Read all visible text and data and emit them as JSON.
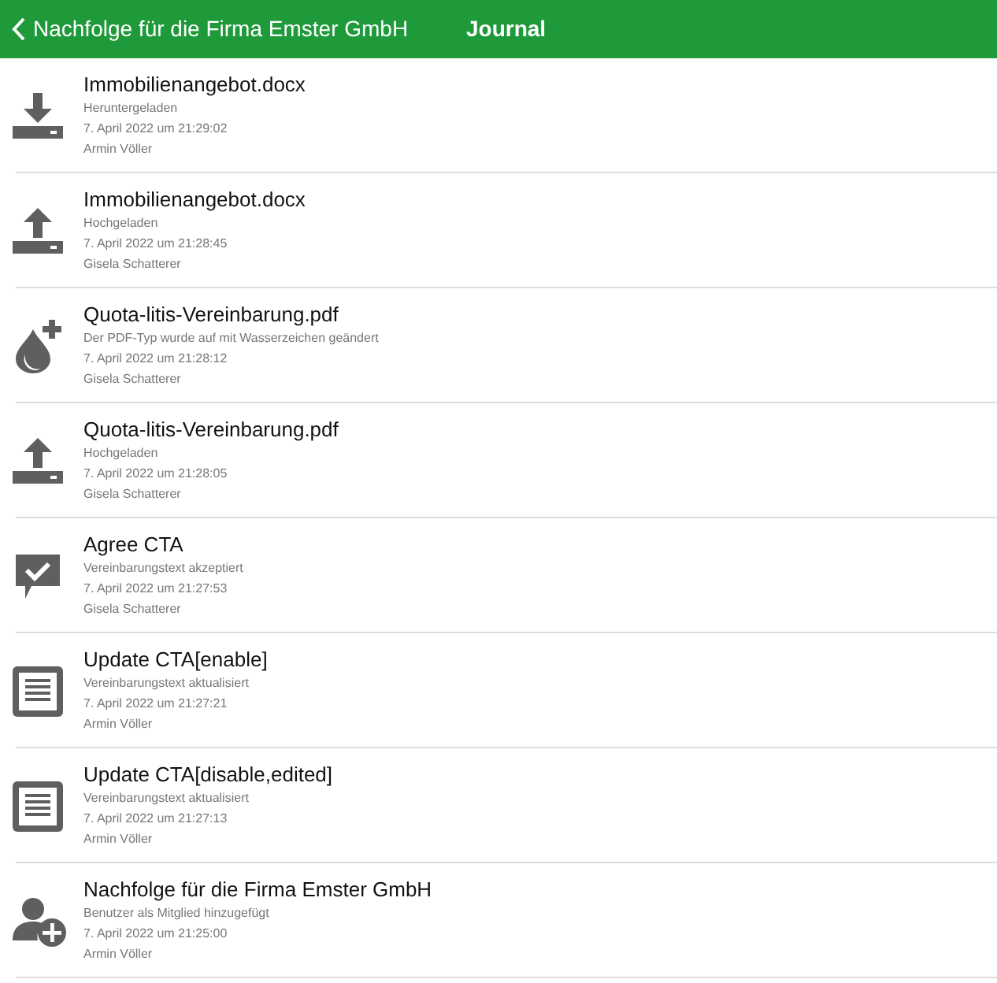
{
  "header": {
    "back_label": "Nachfolge für die Firma Emster GmbH",
    "title": "Journal"
  },
  "entries": [
    {
      "kind": "download",
      "title": "Immobilienangebot.docx",
      "action": "Heruntergeladen",
      "time": "7. April 2022 um 21:29:02",
      "user": "Armin Völler"
    },
    {
      "kind": "upload",
      "title": "Immobilienangebot.docx",
      "action": "Hochgeladen",
      "time": "7. April 2022 um 21:28:45",
      "user": "Gisela Schatterer"
    },
    {
      "kind": "watermark",
      "title": "Quota-litis-Vereinbarung.pdf",
      "action": "Der PDF-Typ wurde auf mit Wasserzeichen geändert",
      "time": "7. April 2022 um 21:28:12",
      "user": "Gisela Schatterer"
    },
    {
      "kind": "upload",
      "title": "Quota-litis-Vereinbarung.pdf",
      "action": "Hochgeladen",
      "time": "7. April 2022 um 21:28:05",
      "user": "Gisela Schatterer"
    },
    {
      "kind": "agree",
      "title": "Agree CTA",
      "action": "Vereinbarungstext akzeptiert",
      "time": "7. April 2022 um 21:27:53",
      "user": "Gisela Schatterer"
    },
    {
      "kind": "document",
      "title": "Update CTA[enable]",
      "action": "Vereinbarungstext aktualisiert",
      "time": "7. April 2022 um 21:27:21",
      "user": "Armin Völler"
    },
    {
      "kind": "document",
      "title": "Update CTA[disable,edited]",
      "action": "Vereinbarungstext aktualisiert",
      "time": "7. April 2022 um 21:27:13",
      "user": "Armin Völler"
    },
    {
      "kind": "add_user",
      "title": "Nachfolge für die Firma Emster GmbH",
      "action": "Benutzer als Mitglied hinzugefügt",
      "time": "7. April 2022 um 21:25:00",
      "user": "Armin Völler"
    }
  ]
}
